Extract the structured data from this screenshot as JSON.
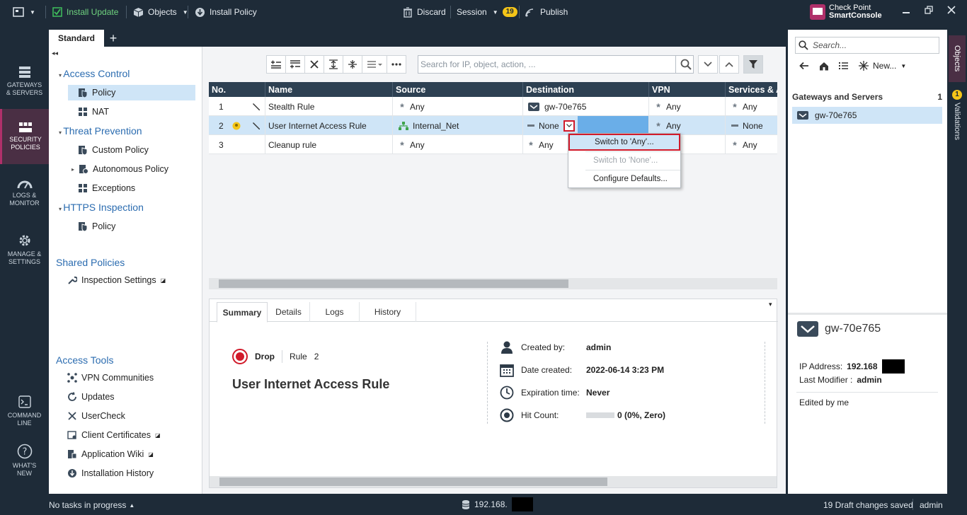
{
  "topbar": {
    "install_update": "Install Update",
    "objects": "Objects",
    "install_policy": "Install Policy",
    "discard": "Discard",
    "session": "Session",
    "session_count": "19",
    "publish": "Publish",
    "brand_line1": "Check Point",
    "brand_line2": "SmartConsole"
  },
  "leftnav": {
    "gateways": [
      "GATEWAYS",
      "& SERVERS"
    ],
    "security": [
      "SECURITY",
      "POLICIES"
    ],
    "logs": [
      "LOGS &",
      "MONITOR"
    ],
    "manage": [
      "MANAGE &",
      "SETTINGS"
    ],
    "cmdline": [
      "COMMAND",
      "LINE"
    ],
    "whatsnew": [
      "WHAT'S",
      "NEW"
    ]
  },
  "policy_tab": {
    "name": "Standard",
    "add": "+"
  },
  "tree": {
    "access_control": "Access Control",
    "policy": "Policy",
    "nat": "NAT",
    "threat_prevention": "Threat Prevention",
    "custom_policy": "Custom Policy",
    "autonomous_policy": "Autonomous Policy",
    "exceptions": "Exceptions",
    "https_inspection": "HTTPS Inspection",
    "https_policy": "Policy",
    "shared_policies": "Shared Policies",
    "inspection_settings": "Inspection Settings",
    "access_tools": "Access Tools",
    "vpn_communities": "VPN Communities",
    "updates": "Updates",
    "usercheck": "UserCheck",
    "client_certificates": "Client Certificates",
    "application_wiki": "Application Wiki",
    "installation_history": "Installation History"
  },
  "search": {
    "placeholder": "Search for IP, object, action, ..."
  },
  "table": {
    "headers": [
      "No.",
      "Name",
      "Source",
      "Destination",
      "VPN",
      "Services & A"
    ],
    "rows": [
      {
        "no": "1",
        "name": "Stealth Rule",
        "source": "Any",
        "destination": "gw-70e765",
        "vpn": "Any",
        "services": "Any"
      },
      {
        "no": "2",
        "name": "User Internet Access Rule",
        "source": "Internal_Net",
        "destination": "None",
        "vpn": "Any",
        "services": "None"
      },
      {
        "no": "3",
        "name": "Cleanup rule",
        "source": "Any",
        "destination": "Any",
        "vpn": "",
        "services": "Any"
      }
    ]
  },
  "context_menu": {
    "switch_any": "Switch to 'Any'...",
    "switch_none": "Switch to 'None'...",
    "configure_defaults": "Configure Defaults..."
  },
  "summary": {
    "tabs": [
      "Summary",
      "Details",
      "Logs",
      "History"
    ],
    "action": "Drop",
    "rule_label": "Rule",
    "rule_no": "2",
    "rule_name": "User Internet Access Rule",
    "created_by_k": "Created by:",
    "created_by_v": "admin",
    "date_created_k": "Date created:",
    "date_created_v": "2022-06-14 3:23 PM",
    "expiration_k": "Expiration time:",
    "expiration_v": "Never",
    "hit_count_k": "Hit Count:",
    "hit_count_v": "0 (0%, Zero)"
  },
  "right": {
    "search_placeholder": "Search...",
    "new": "New...",
    "section": "Gateways and Servers",
    "section_count": "1",
    "item": "gw-70e765",
    "detail_name": "gw-70e765",
    "ip_label": "IP Address:",
    "ip_value": "192.168",
    "last_modifier_label": "Last Modifier :",
    "last_modifier_value": "admin",
    "edited": "Edited by me"
  },
  "vstrip": {
    "objects": "Objects",
    "validations": "Validations",
    "validations_count": "1"
  },
  "status": {
    "tasks": "No tasks in progress",
    "server_ip": "192.168.",
    "drafts": "19 Draft changes saved",
    "user": "admin"
  },
  "colors": {
    "accent": "#2b6cb0",
    "dark": "#1e2b38",
    "selection": "#cfe5f7",
    "drop": "#d11a2a",
    "highlight_border": "#d11a2a",
    "badge": "#f5c518"
  }
}
